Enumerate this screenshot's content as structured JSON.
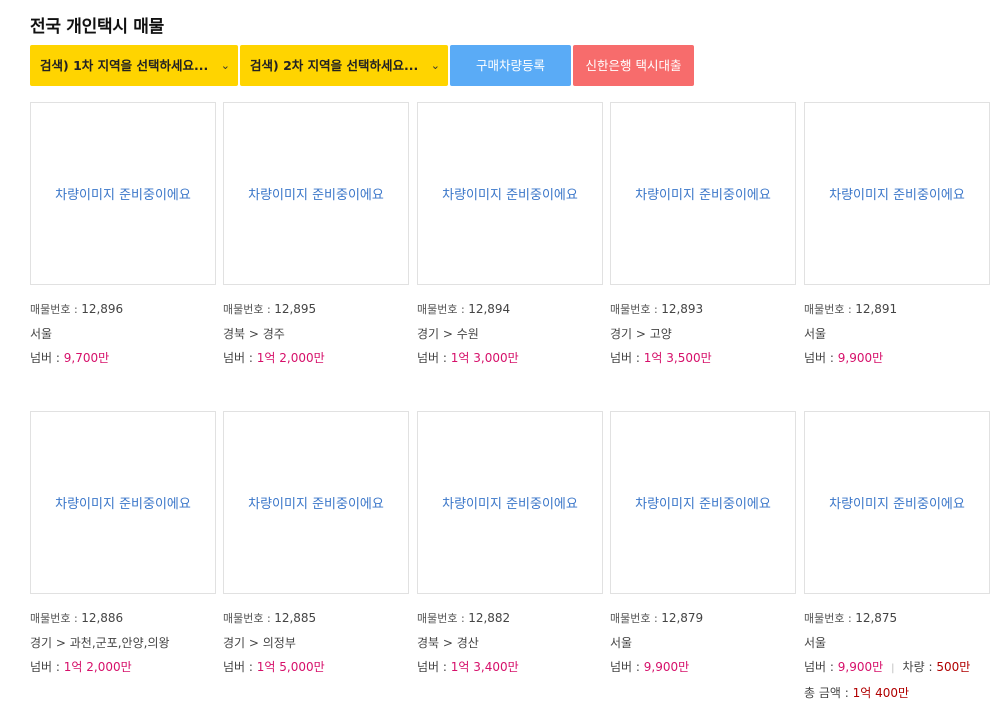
{
  "page_title": "전국 개인택시 매물",
  "toolbar": {
    "region1_label": "검색) 1차 지역을 선택하세요...",
    "region2_label": "검색) 2차 지역을 선택하세요...",
    "chevron": "⌄",
    "register_label": "구매차량등록",
    "loan_label": "신한은행 택시대출"
  },
  "colors": {
    "search_bg": "#ffd400",
    "register_bg": "#5aabf6",
    "loan_bg": "#f76c6c",
    "price": "#d6106a"
  },
  "listings": [
    {
      "image_text": "차량이미지 준비중이에요",
      "no_label": "매물번호 : ",
      "no": "12,896",
      "location": "서울",
      "price_label": "넘버 : ",
      "price": "9,700만"
    },
    {
      "image_text": "차량이미지 준비중이에요",
      "no_label": "매물번호 : ",
      "no": "12,895",
      "location": "경북 > 경주",
      "price_label": "넘버 : ",
      "price": "1억 2,000만"
    },
    {
      "image_text": "차량이미지 준비중이에요",
      "no_label": "매물번호 : ",
      "no": "12,894",
      "location": "경기 > 수원",
      "price_label": "넘버 : ",
      "price": "1억 3,000만"
    },
    {
      "image_text": "차량이미지 준비중이에요",
      "no_label": "매물번호 : ",
      "no": "12,893",
      "location": "경기 > 고양",
      "price_label": "넘버 : ",
      "price": "1억 3,500만"
    },
    {
      "image_text": "차량이미지 준비중이에요",
      "no_label": "매물번호 : ",
      "no": "12,891",
      "location": "서울",
      "price_label": "넘버 : ",
      "price": "9,900만"
    },
    {
      "image_text": "차량이미지 준비중이에요",
      "no_label": "매물번호 : ",
      "no": "12,886",
      "location": "경기 > 과천,군포,안양,의왕",
      "price_label": "넘버 : ",
      "price": "1억 2,000만"
    },
    {
      "image_text": "차량이미지 준비중이에요",
      "no_label": "매물번호 : ",
      "no": "12,885",
      "location": "경기 > 의정부",
      "price_label": "넘버 : ",
      "price": "1억 5,000만"
    },
    {
      "image_text": "차량이미지 준비중이에요",
      "no_label": "매물번호 : ",
      "no": "12,882",
      "location": "경북 > 경산",
      "price_label": "넘버 : ",
      "price": "1억 3,400만"
    },
    {
      "image_text": "차량이미지 준비중이에요",
      "no_label": "매물번호 : ",
      "no": "12,879",
      "location": "서울",
      "price_label": "넘버 : ",
      "price": "9,900만"
    },
    {
      "image_text": "차량이미지 준비중이에요",
      "no_label": "매물번호 : ",
      "no": "12,875",
      "location": "서울",
      "price_label": "넘버 : ",
      "price": "9,900만",
      "separator": "|",
      "car_label": "차량 : ",
      "car_price": "500만",
      "total_label": "총 금액 : ",
      "total_price": "1억 400만"
    }
  ]
}
